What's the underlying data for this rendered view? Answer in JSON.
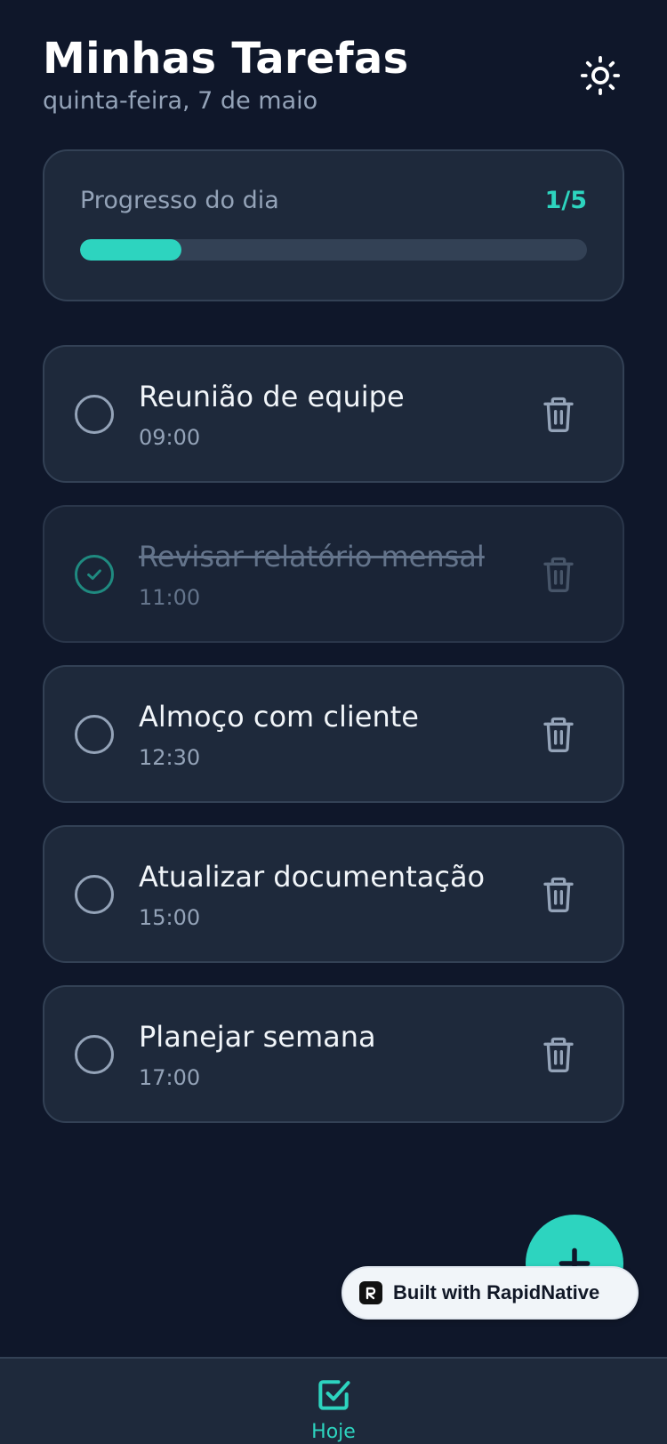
{
  "header": {
    "title": "Minhas Tarefas",
    "date": "quinta-feira, 7 de maio",
    "theme_icon": "sun-icon"
  },
  "progress": {
    "label": "Progresso do dia",
    "count": "1/5",
    "completed": 1,
    "total": 5,
    "accent": "#2dd4bf"
  },
  "tasks": [
    {
      "name": "Reunião de equipe",
      "time": "09:00",
      "done": false
    },
    {
      "name": "Revisar relatório mensal",
      "time": "11:00",
      "done": true
    },
    {
      "name": "Almoço com cliente",
      "time": "12:30",
      "done": false
    },
    {
      "name": "Atualizar documentação",
      "time": "15:00",
      "done": false
    },
    {
      "name": "Planejar semana",
      "time": "17:00",
      "done": false
    }
  ],
  "fab": {
    "icon": "plus-icon"
  },
  "badge": {
    "text": "Built with RapidNative"
  },
  "tabbar": {
    "tabs": [
      {
        "label": "Hoje",
        "icon": "checkbox-icon",
        "active": true
      }
    ]
  },
  "colors": {
    "background": "#0f172a",
    "card": "#1e293b",
    "accent": "#2dd4bf",
    "muted": "#94a3b8"
  }
}
